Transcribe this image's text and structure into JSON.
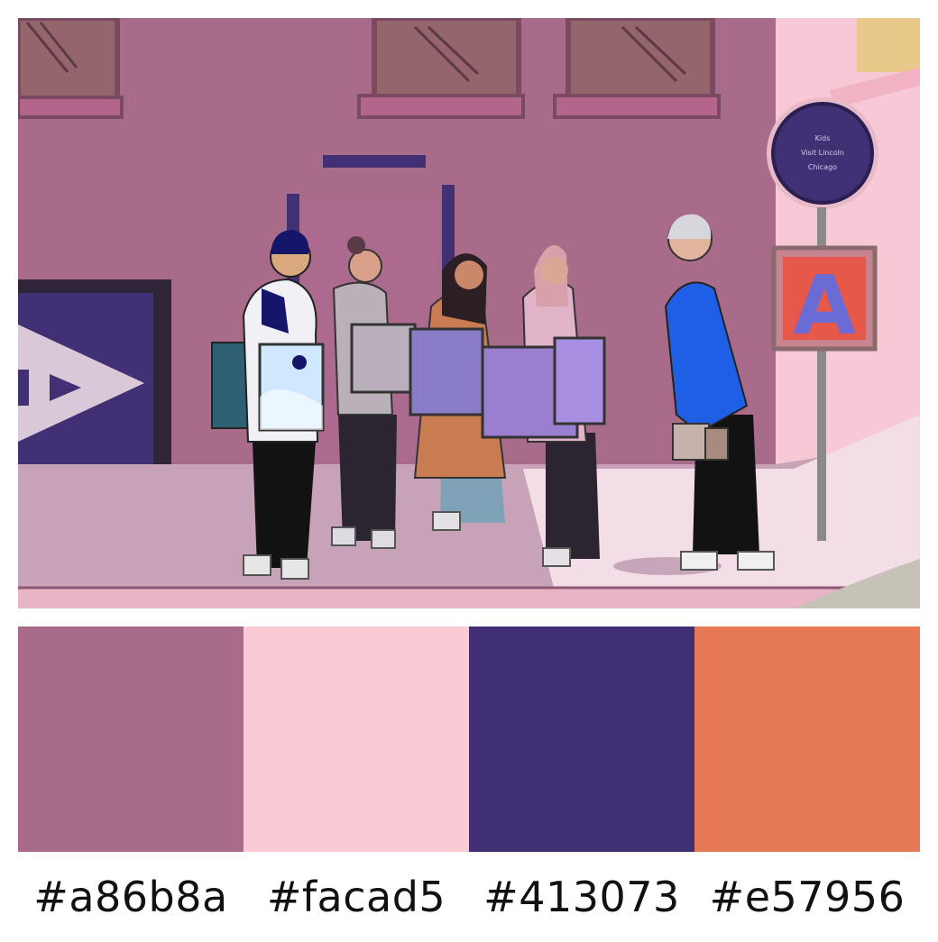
{
  "palette": {
    "swatches": [
      {
        "hex": "#a86b8a",
        "label": "#a86b8a"
      },
      {
        "hex": "#facad5",
        "label": "#facad5"
      },
      {
        "hex": "#413073",
        "label": "#413073"
      },
      {
        "hex": "#e57956",
        "label": "#e57956"
      }
    ]
  },
  "illustration": {
    "sign_text": [
      "Kids",
      "Visit Lincoln",
      "Chicago"
    ],
    "sign_letter": "A",
    "colors": {
      "wall": "#a86b8a",
      "wall_dark": "#8f5775",
      "sidewalk": "#c8a2b6",
      "sidewalk_light": "#f3dde6",
      "building_right": "#f7c9d6",
      "window": "#94656a",
      "navy": "#413073",
      "orange": "#e57956",
      "blue": "#1f5fe6"
    }
  }
}
